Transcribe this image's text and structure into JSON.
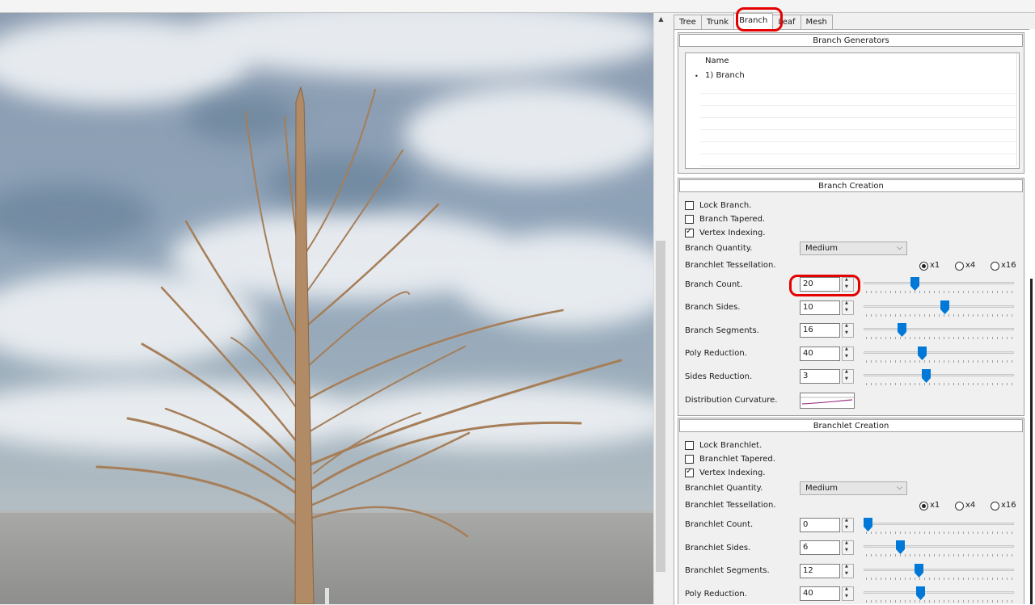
{
  "colors": {
    "accent": "#0078d7",
    "highlight": "#e50000"
  },
  "tabs": [
    {
      "label": "Tree"
    },
    {
      "label": "Trunk"
    },
    {
      "label": "Branch"
    },
    {
      "label": "Leaf"
    },
    {
      "label": "Mesh"
    }
  ],
  "generators": {
    "title": "Branch Generators",
    "column": "Name",
    "items": [
      "1) Branch"
    ]
  },
  "branch": {
    "title": "Branch Creation",
    "checks": [
      {
        "label": "Lock Branch.",
        "checked": false
      },
      {
        "label": "Branch Tapered.",
        "checked": false
      },
      {
        "label": "Vertex Indexing.",
        "checked": true
      }
    ],
    "quantity": {
      "label": "Branch Quantity.",
      "value": "Medium"
    },
    "tessellation": {
      "label": "Branchlet Tessellation.",
      "options": [
        "x1",
        "x4",
        "x16"
      ],
      "selected": "x1"
    },
    "params": [
      {
        "label": "Branch Count.",
        "value": "20",
        "position": 0.33
      },
      {
        "label": "Branch Sides.",
        "value": "10",
        "position": 0.54
      },
      {
        "label": "Branch Segments.",
        "value": "16",
        "position": 0.24
      },
      {
        "label": "Poly Reduction.",
        "value": "40",
        "position": 0.38
      },
      {
        "label": "Sides Reduction.",
        "value": "3",
        "position": 0.41
      }
    ],
    "curvature": {
      "label": "Distribution Curvature."
    }
  },
  "branchlet": {
    "title": "Branchlet Creation",
    "checks": [
      {
        "label": "Lock Branchlet.",
        "checked": false
      },
      {
        "label": "Branchlet Tapered.",
        "checked": false
      },
      {
        "label": "Vertex Indexing.",
        "checked": true
      }
    ],
    "quantity": {
      "label": "Branchlet Quantity.",
      "value": "Medium"
    },
    "tessellation": {
      "label": "Branchlet Tessellation.",
      "options": [
        "x1",
        "x4",
        "x16"
      ],
      "selected": "x1"
    },
    "params": [
      {
        "label": "Branchlet Count.",
        "value": "0",
        "position": 0.0
      },
      {
        "label": "Branchlet Sides.",
        "value": "6",
        "position": 0.23
      },
      {
        "label": "Branchlet Segments.",
        "value": "12",
        "position": 0.36
      },
      {
        "label": "Poly Reduction.",
        "value": "40",
        "position": 0.37
      }
    ]
  }
}
